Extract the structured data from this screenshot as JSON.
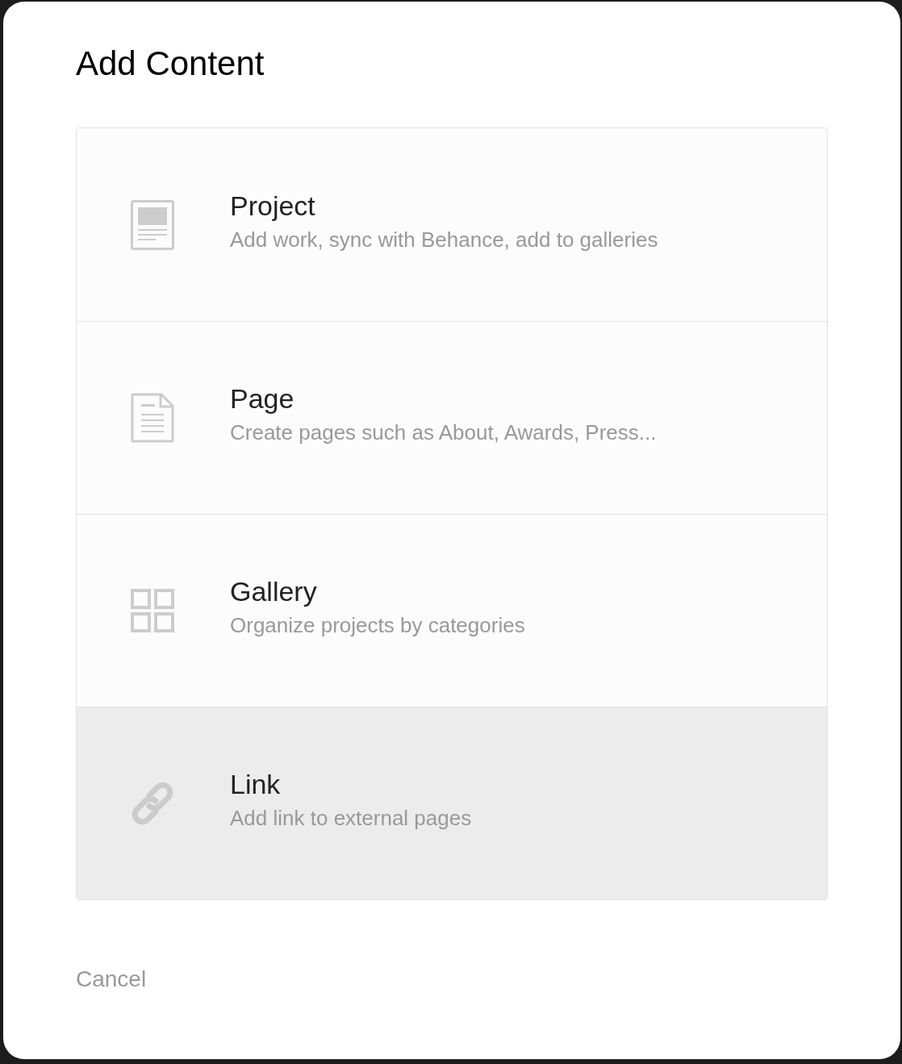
{
  "dialog": {
    "title": "Add Content",
    "options": [
      {
        "kind": "project",
        "title": "Project",
        "description": "Add work, sync with Behance, add to galleries",
        "selected": false
      },
      {
        "kind": "page",
        "title": "Page",
        "description": "Create pages such as About, Awards, Press...",
        "selected": false
      },
      {
        "kind": "gallery",
        "title": "Gallery",
        "description": "Organize projects by categories",
        "selected": false
      },
      {
        "kind": "link",
        "title": "Link",
        "description": "Add link to external pages",
        "selected": true
      }
    ],
    "cancel": "Cancel"
  }
}
